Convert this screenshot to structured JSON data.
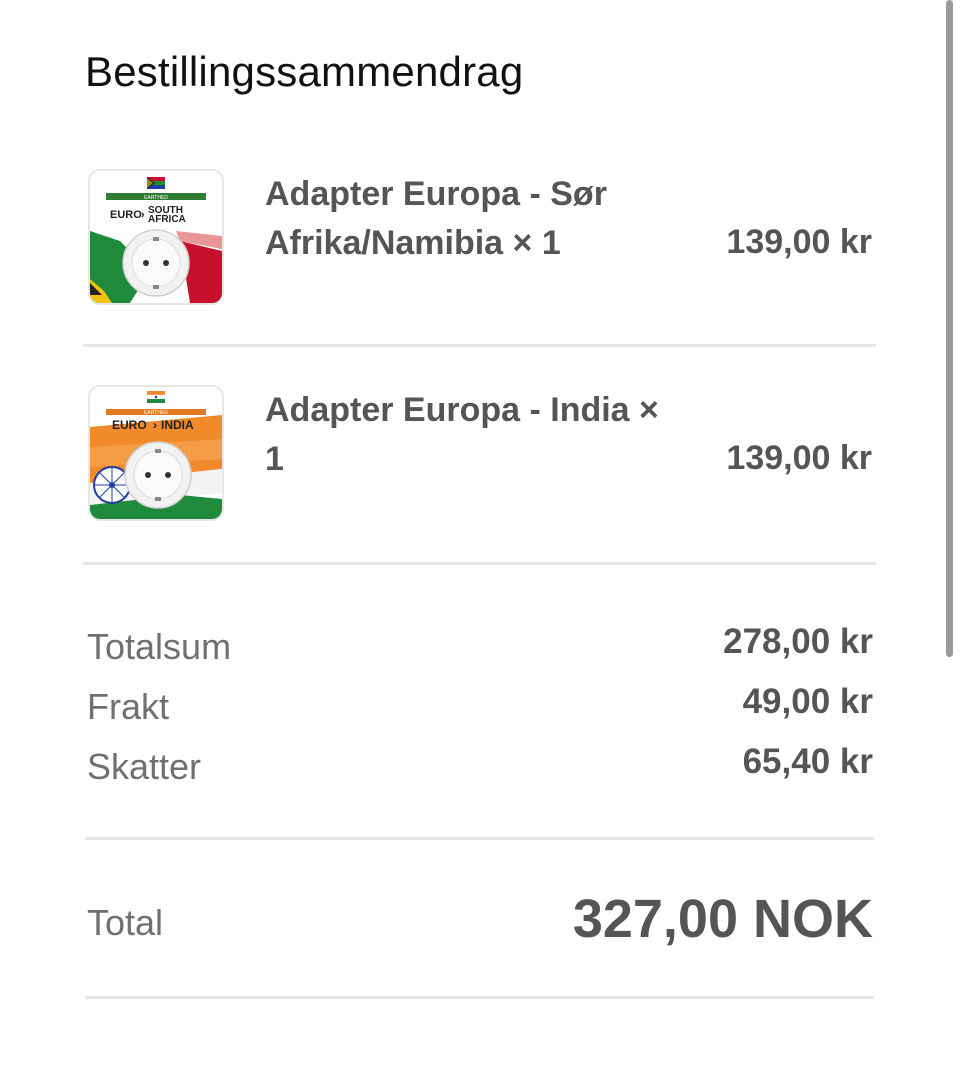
{
  "order_summary": {
    "title": "Bestillingssammendrag",
    "items": [
      {
        "name": "Adapter Europa - Sør Afrika/Namibia × 1",
        "price": "139,00 kr",
        "thumb": {
          "brand": "EARTHED",
          "from": "EURO",
          "to_line1": "SOUTH",
          "to_line2": "AFRICA",
          "flag": "south-africa-flag-icon"
        }
      },
      {
        "name": "Adapter Europa - India × 1",
        "price": "139,00 kr",
        "thumb": {
          "brand": "EARTHED",
          "from": "EURO",
          "to_line1": "INDIA",
          "flag": "india-flag-icon"
        }
      }
    ],
    "totals": {
      "subtotal_label": "Totalsum",
      "subtotal_value": "278,00 kr",
      "shipping_label": "Frakt",
      "shipping_value": "49,00 kr",
      "taxes_label": "Skatter",
      "taxes_value": "65,40 kr"
    },
    "grand_total": {
      "label": "Total",
      "value": "327,00 NOK"
    }
  },
  "colors": {
    "text_dark": "#111111",
    "text_value": "#555555",
    "text_label": "#707070",
    "divider": "#e6e6e6",
    "scrollbar": "#9a9a9a"
  }
}
